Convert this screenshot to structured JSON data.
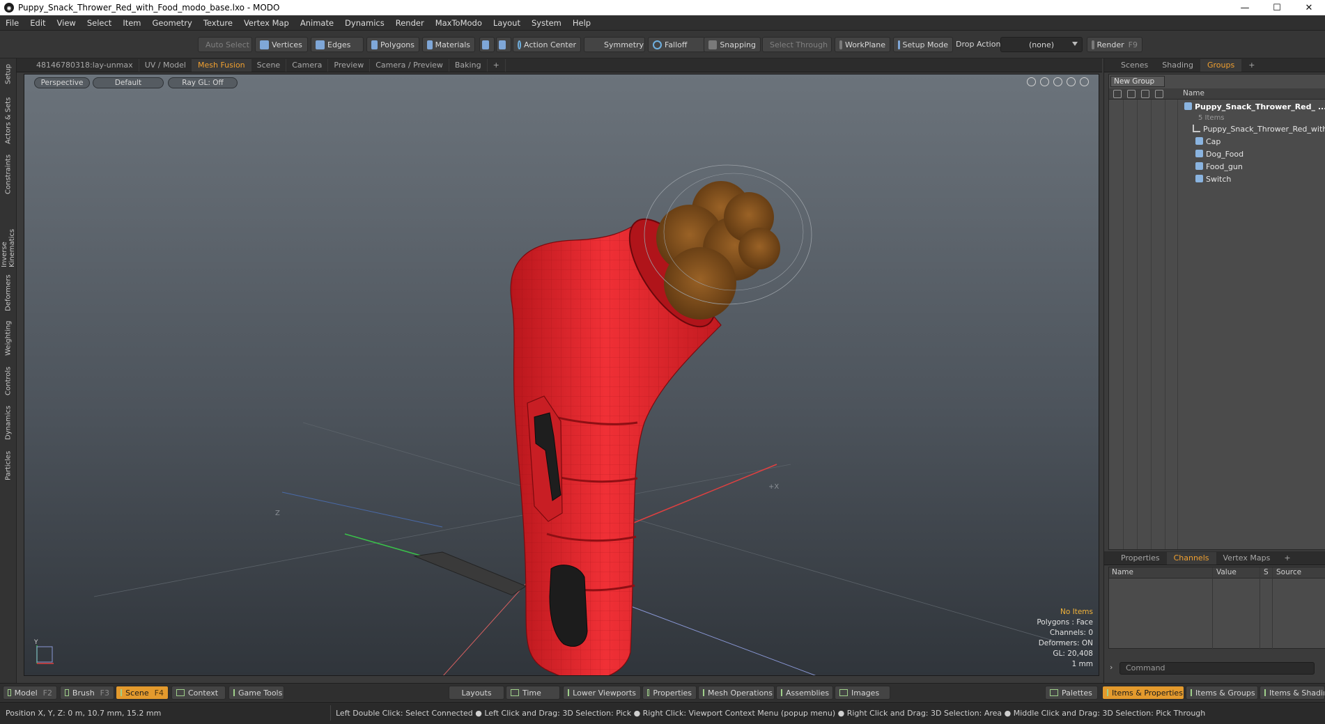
{
  "window": {
    "title": "Puppy_Snack_Thrower_Red_with_Food_modo_base.lxo - MODO",
    "min": "—",
    "max": "☐",
    "close": "✕"
  },
  "menu": [
    "File",
    "Edit",
    "View",
    "Select",
    "Item",
    "Geometry",
    "Texture",
    "Vertex Map",
    "Animate",
    "Dynamics",
    "Render",
    "MaxToModo",
    "Layout",
    "System",
    "Help"
  ],
  "toolbar": {
    "auto_select": "Auto Select",
    "vertices": "Vertices",
    "edges": "Edges",
    "polygons": "Polygons",
    "materials": "Materials",
    "action_center": "Action Center",
    "symmetry": "Symmetry",
    "falloff": "Falloff",
    "snapping": "Snapping",
    "select_through": "Select Through",
    "workplane": "WorkPlane",
    "setup_mode": "Setup Mode",
    "drop_action_label": "Drop Action",
    "drop_action_value": "(none)",
    "render": "Render",
    "render_key": "F9"
  },
  "left_tabs": [
    "Setup",
    "Actors & Sets",
    "Constraints",
    "Inverse Kinematics",
    "Deformers",
    "Weighting",
    "Controls",
    "Dynamics",
    "Particles"
  ],
  "viewport_tabs": [
    "48146780318:lay-unmax",
    "UV / Model",
    "Mesh Fusion",
    "Scene",
    "Camera",
    "Preview",
    "Camera / Preview",
    "Baking",
    "+"
  ],
  "viewport": {
    "perspective": "Perspective",
    "default": "Default",
    "raygl": "Ray GL: Off",
    "info": {
      "items": "No Items",
      "polygons": "Polygons : Face",
      "channels": "Channels: 0",
      "deformers": "Deformers: ON",
      "gl": "GL: 20,408",
      "scale": "1 mm"
    },
    "axis_labels": {
      "z": "Z",
      "x": "+X",
      "y": "Y"
    }
  },
  "right_tabs_top": [
    "Scenes",
    "Shading",
    "Groups",
    "+"
  ],
  "groups": {
    "new_group": "New Group",
    "name_col": "Name",
    "root": "Puppy_Snack_Thrower_Red_ ...",
    "root_count": "5 Items",
    "items": [
      "Puppy_Snack_Thrower_Red_with...",
      "Cap",
      "Dog_Food",
      "Food_gun",
      "Switch"
    ]
  },
  "right_tabs_bottom": [
    "Properties",
    "Channels",
    "Vertex Maps",
    "+"
  ],
  "channels": {
    "name": "Name",
    "value": "Value",
    "s": "S",
    "source": "Source"
  },
  "command_placeholder": "Command",
  "bottombar": {
    "model": "Model",
    "model_key": "F2",
    "brush": "Brush",
    "brush_key": "F3",
    "scene": "Scene",
    "scene_key": "F4",
    "context": "Context",
    "game_tools": "Game Tools",
    "layouts": "Layouts",
    "time": "Time",
    "lower_viewports": "Lower Viewports",
    "properties": "Properties",
    "mesh_operations": "Mesh Operations",
    "assemblies": "Assemblies",
    "images": "Images",
    "palettes": "Palettes",
    "items_properties": "Items & Properties",
    "items_groups": "Items & Groups",
    "items_shading": "Items & Shadin"
  },
  "status": {
    "position": "Position X, Y, Z:   0 m, 10.7 mm, 15.2 mm",
    "hints": "Left Double Click: Select Connected ● Left Click and Drag: 3D Selection: Pick ● Right Click: Viewport Context Menu (popup menu) ● Right Click and Drag: 3D Selection: Area ● Middle Click and Drag: 3D Selection: Pick Through"
  },
  "colors": {
    "accent": "#f0a030",
    "model_red": "#e3262c",
    "food_brown": "#7a4a1a"
  }
}
